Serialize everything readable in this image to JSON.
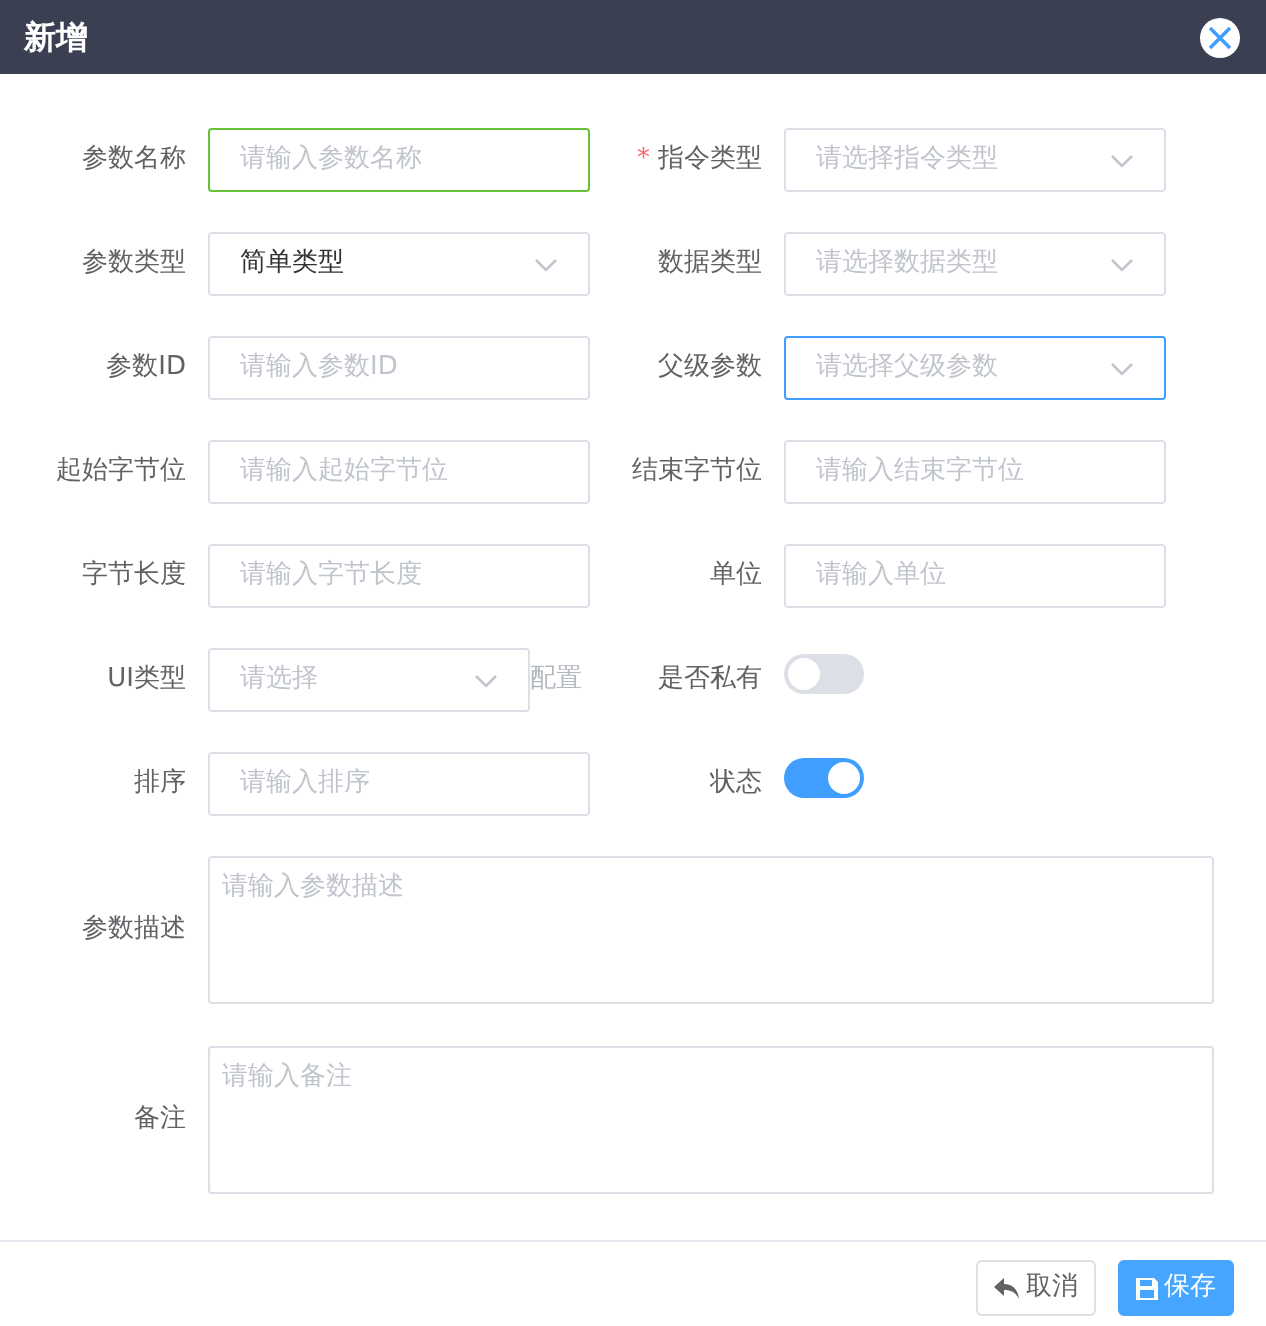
{
  "dialog": {
    "title": "新增"
  },
  "rows": [
    [
      {
        "label": "参数名称",
        "kind": "input",
        "placeholder": "请输入参数名称",
        "valid": true
      },
      {
        "label": "指令类型",
        "kind": "select",
        "placeholder": "请选择指令类型",
        "required_mark": "*"
      }
    ],
    [
      {
        "label": "参数类型",
        "kind": "select",
        "value": "简单类型"
      },
      {
        "label": "数据类型",
        "kind": "select",
        "placeholder": "请选择数据类型"
      }
    ],
    [
      {
        "label": "参数ID",
        "kind": "input",
        "placeholder": "请输入参数ID"
      },
      {
        "label": "父级参数",
        "kind": "select",
        "placeholder": "请选择父级参数",
        "focused": true
      }
    ],
    [
      {
        "label": "起始字节位",
        "kind": "input",
        "placeholder": "请输入起始字节位"
      },
      {
        "label": "结束字节位",
        "kind": "input",
        "placeholder": "请输入结束字节位"
      }
    ],
    [
      {
        "label": "字节长度",
        "kind": "input",
        "placeholder": "请输入字节长度"
      },
      {
        "label": "单位",
        "kind": "input",
        "placeholder": "请输入单位"
      }
    ],
    [
      {
        "label": "UI类型",
        "kind": "select",
        "placeholder": "请选择",
        "extra": "配置"
      },
      {
        "label": "是否私有",
        "kind": "switch",
        "on": false
      }
    ],
    [
      {
        "label": "排序",
        "kind": "input",
        "placeholder": "请输入排序"
      },
      {
        "label": "状态",
        "kind": "switch",
        "on": true
      }
    ]
  ],
  "textareas": [
    {
      "label": "参数描述",
      "placeholder": "请输入参数描述"
    },
    {
      "label": "备注",
      "placeholder": "请输入备注"
    }
  ],
  "buttons": [
    {
      "label": "取消",
      "kind": "cancel"
    },
    {
      "label": "保存",
      "kind": "save"
    }
  ]
}
